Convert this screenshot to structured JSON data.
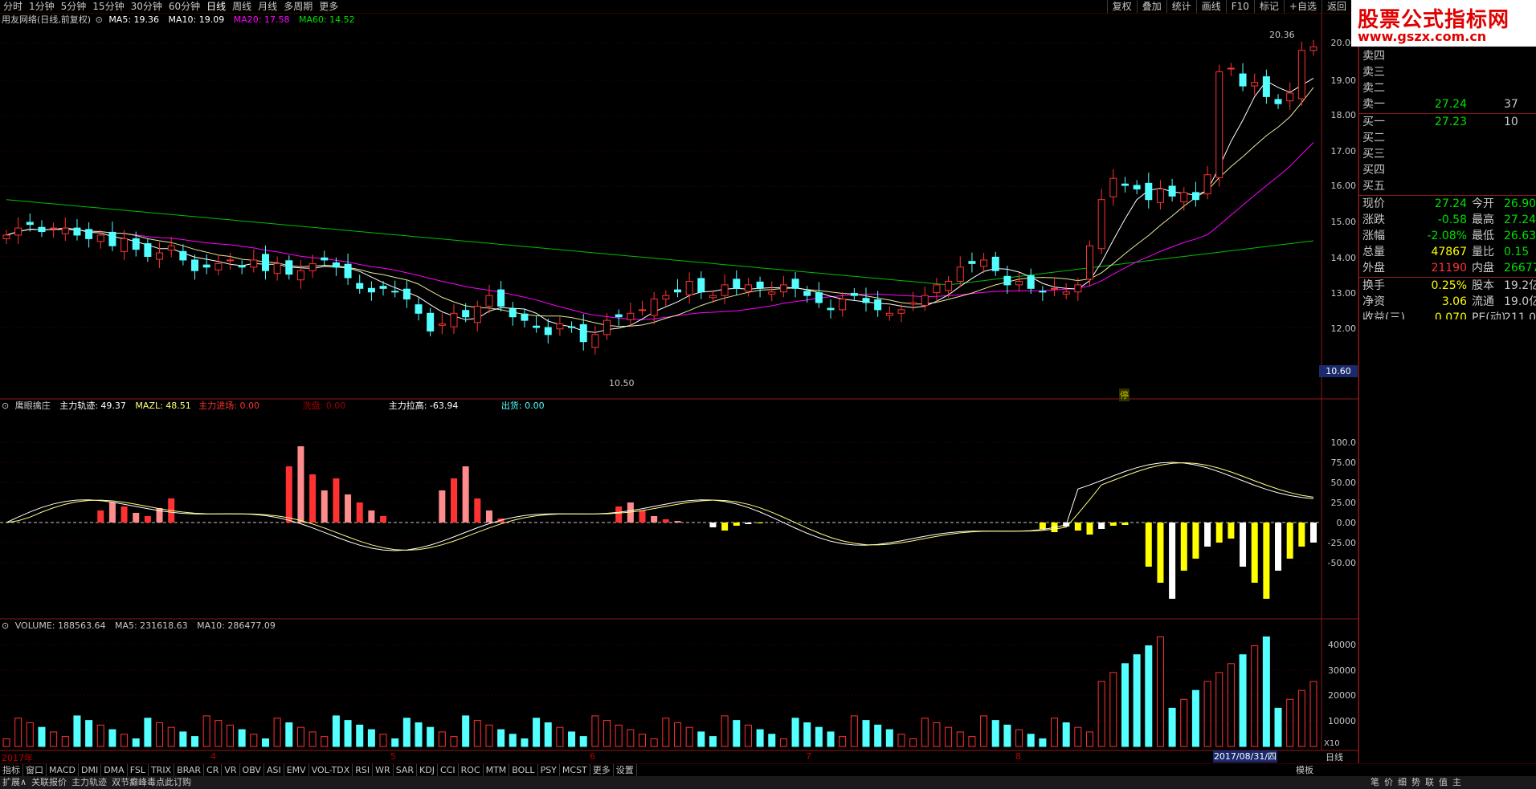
{
  "topbar": {
    "periods": [
      "分时",
      "1分钟",
      "5分钟",
      "15分钟",
      "30分钟",
      "60分钟",
      "日线",
      "周线",
      "月线",
      "多周期",
      "更多"
    ],
    "active": "日线",
    "right_tools": [
      "复权",
      "叠加",
      "统计",
      "画线",
      "F10",
      "标记",
      "+自选",
      "返回"
    ]
  },
  "logo": {
    "line1": "股票公式指标网",
    "line2": "www.gszx.com.cn"
  },
  "price_panel": {
    "title": "用友网络(日线,前复权)",
    "ma5": "MA5: 19.36",
    "ma10": "MA10: 19.09",
    "ma20": "MA20: 17.58",
    "ma60": "MA60: 14.52",
    "high_marker": "20.36",
    "low_marker": "10.50",
    "low_price_box": "10.60",
    "y_ticks": [
      "20.00",
      "19.00",
      "18.00",
      "17.00",
      "16.00",
      "15.00",
      "14.00",
      "13.00",
      "12.00"
    ],
    "event_marker": "停"
  },
  "indicator_panel": {
    "name": "鹰眼擒庄",
    "main_track": "主力轨迹: 49.37",
    "mazl": "MAZL: 48.51",
    "enter": "主力进场: 0.00",
    "wash": "洗盘: 0.00",
    "pull": "主力拉高: -63.94",
    "out": "出货: 0.00",
    "y_ticks": [
      "100.0",
      "75.00",
      "50.00",
      "25.00",
      "0.00",
      "-25.00",
      "-50.00"
    ]
  },
  "volume_panel": {
    "label": "VOLUME: 188563.64",
    "ma5": "MA5: 231618.63",
    "ma10": "MA10: 286477.09",
    "y_ticks": [
      "40000",
      "30000",
      "20000",
      "10000"
    ],
    "unit": "X10"
  },
  "date_axis": {
    "labels": [
      "2017年",
      "4",
      "5",
      "6",
      "7",
      "8"
    ],
    "current_date": "2017/08/31/四",
    "period_button": "日线"
  },
  "quote": {
    "sells": [
      {
        "k": "卖四",
        "v": "",
        "n": ""
      },
      {
        "k": "卖三",
        "v": "",
        "n": ""
      },
      {
        "k": "卖二",
        "v": "",
        "n": ""
      },
      {
        "k": "卖一",
        "v": "27.24",
        "n": "37"
      }
    ],
    "buys": [
      {
        "k": "买一",
        "v": "27.23",
        "n": "10"
      },
      {
        "k": "买二",
        "v": "",
        "n": ""
      },
      {
        "k": "买三",
        "v": "",
        "n": ""
      },
      {
        "k": "买四",
        "v": "",
        "n": ""
      },
      {
        "k": "买五",
        "v": "",
        "n": ""
      }
    ],
    "stats": [
      {
        "k": "现价",
        "v": "27.24",
        "k2": "今开",
        "v2": "26.90"
      },
      {
        "k": "涨跌",
        "v": "-0.58",
        "k2": "最高",
        "v2": "27.24"
      },
      {
        "k": "涨幅",
        "v": "-2.08%",
        "k2": "最低",
        "v2": "26.63"
      },
      {
        "k": "总量",
        "v": "47867",
        "k2": "量比",
        "v2": "0.15"
      },
      {
        "k": "外盘",
        "v": "21190",
        "k2": "内盘",
        "v2": "26677"
      },
      {
        "k": "换手",
        "v": "0.25%",
        "k2": "股本",
        "v2": "19.2亿"
      },
      {
        "k": "净资",
        "v": "3.06",
        "k2": "流通",
        "v2": "19.0亿"
      },
      {
        "k": "收益(三)",
        "v": "0.070",
        "k2": "PE(动)",
        "v2": "211.0"
      }
    ]
  },
  "bottom_tabs": [
    "指标",
    "窗口",
    "MACD",
    "DMI",
    "DMA",
    "FSL",
    "TRIX",
    "BRAR",
    "CR",
    "VR",
    "OBV",
    "ASI",
    "EMV",
    "VOL-TDX",
    "RSI",
    "WR",
    "SAR",
    "KDJ",
    "CCI",
    "ROC",
    "MTM",
    "BOLL",
    "PSY",
    "MCST",
    "更多",
    "设置"
  ],
  "bottom_right": "模板",
  "status_bar": [
    "扩展∧",
    "关联报价",
    "主力轨迹",
    "双节癫峰毒点此订购"
  ],
  "status_right": [
    "笔",
    "价",
    "细",
    "势",
    "联",
    "值",
    "主"
  ],
  "colors": {
    "up": "#ff3232",
    "down": "#54ffff",
    "ma5": "#ffffff",
    "ma10": "#ffff00",
    "ma20": "#ff00ff",
    "ma60": "#00c000",
    "grid": "#8b1a1a",
    "yellow": "#ffff00",
    "pink": "#ff8c8c"
  }
}
